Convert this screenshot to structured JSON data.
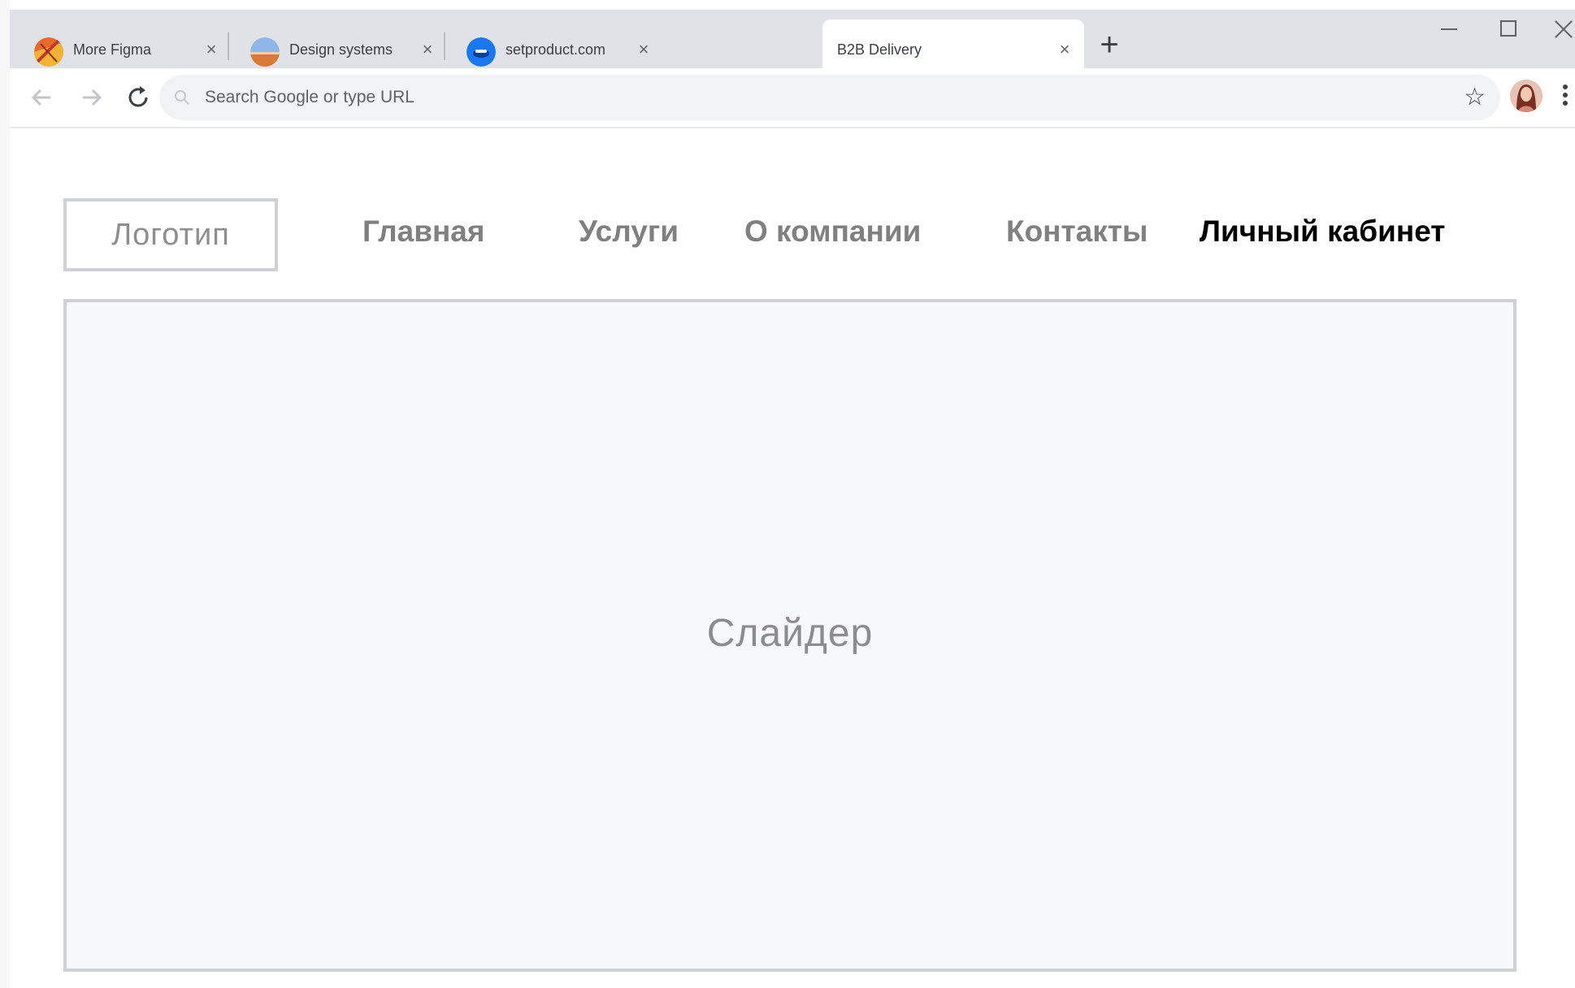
{
  "browser": {
    "tabs": [
      {
        "title": "More Figma",
        "active": false
      },
      {
        "title": "Design systems",
        "active": false
      },
      {
        "title": "setproduct.com",
        "active": false
      },
      {
        "title": "B2B Delivery",
        "active": true
      }
    ],
    "new_tab_icon": "plus-icon",
    "window_controls": [
      "minimize-icon",
      "maximize-icon",
      "close-icon"
    ],
    "omnibox": {
      "placeholder": "Search Google or type URL"
    }
  },
  "site": {
    "logo": "Логотип",
    "nav": [
      "Главная",
      "Услуги",
      "О компании",
      "Контакты",
      "Личный кабинет"
    ],
    "slider": "Слайдер"
  },
  "colors": {
    "tabstrip": "#dfe3e8",
    "active_tab": "#ffffff",
    "nav_muted": "#808080",
    "nav_active": "#000000",
    "wireframe_border": "#cfd2d5",
    "slider_bg": "#f7f8fa"
  }
}
